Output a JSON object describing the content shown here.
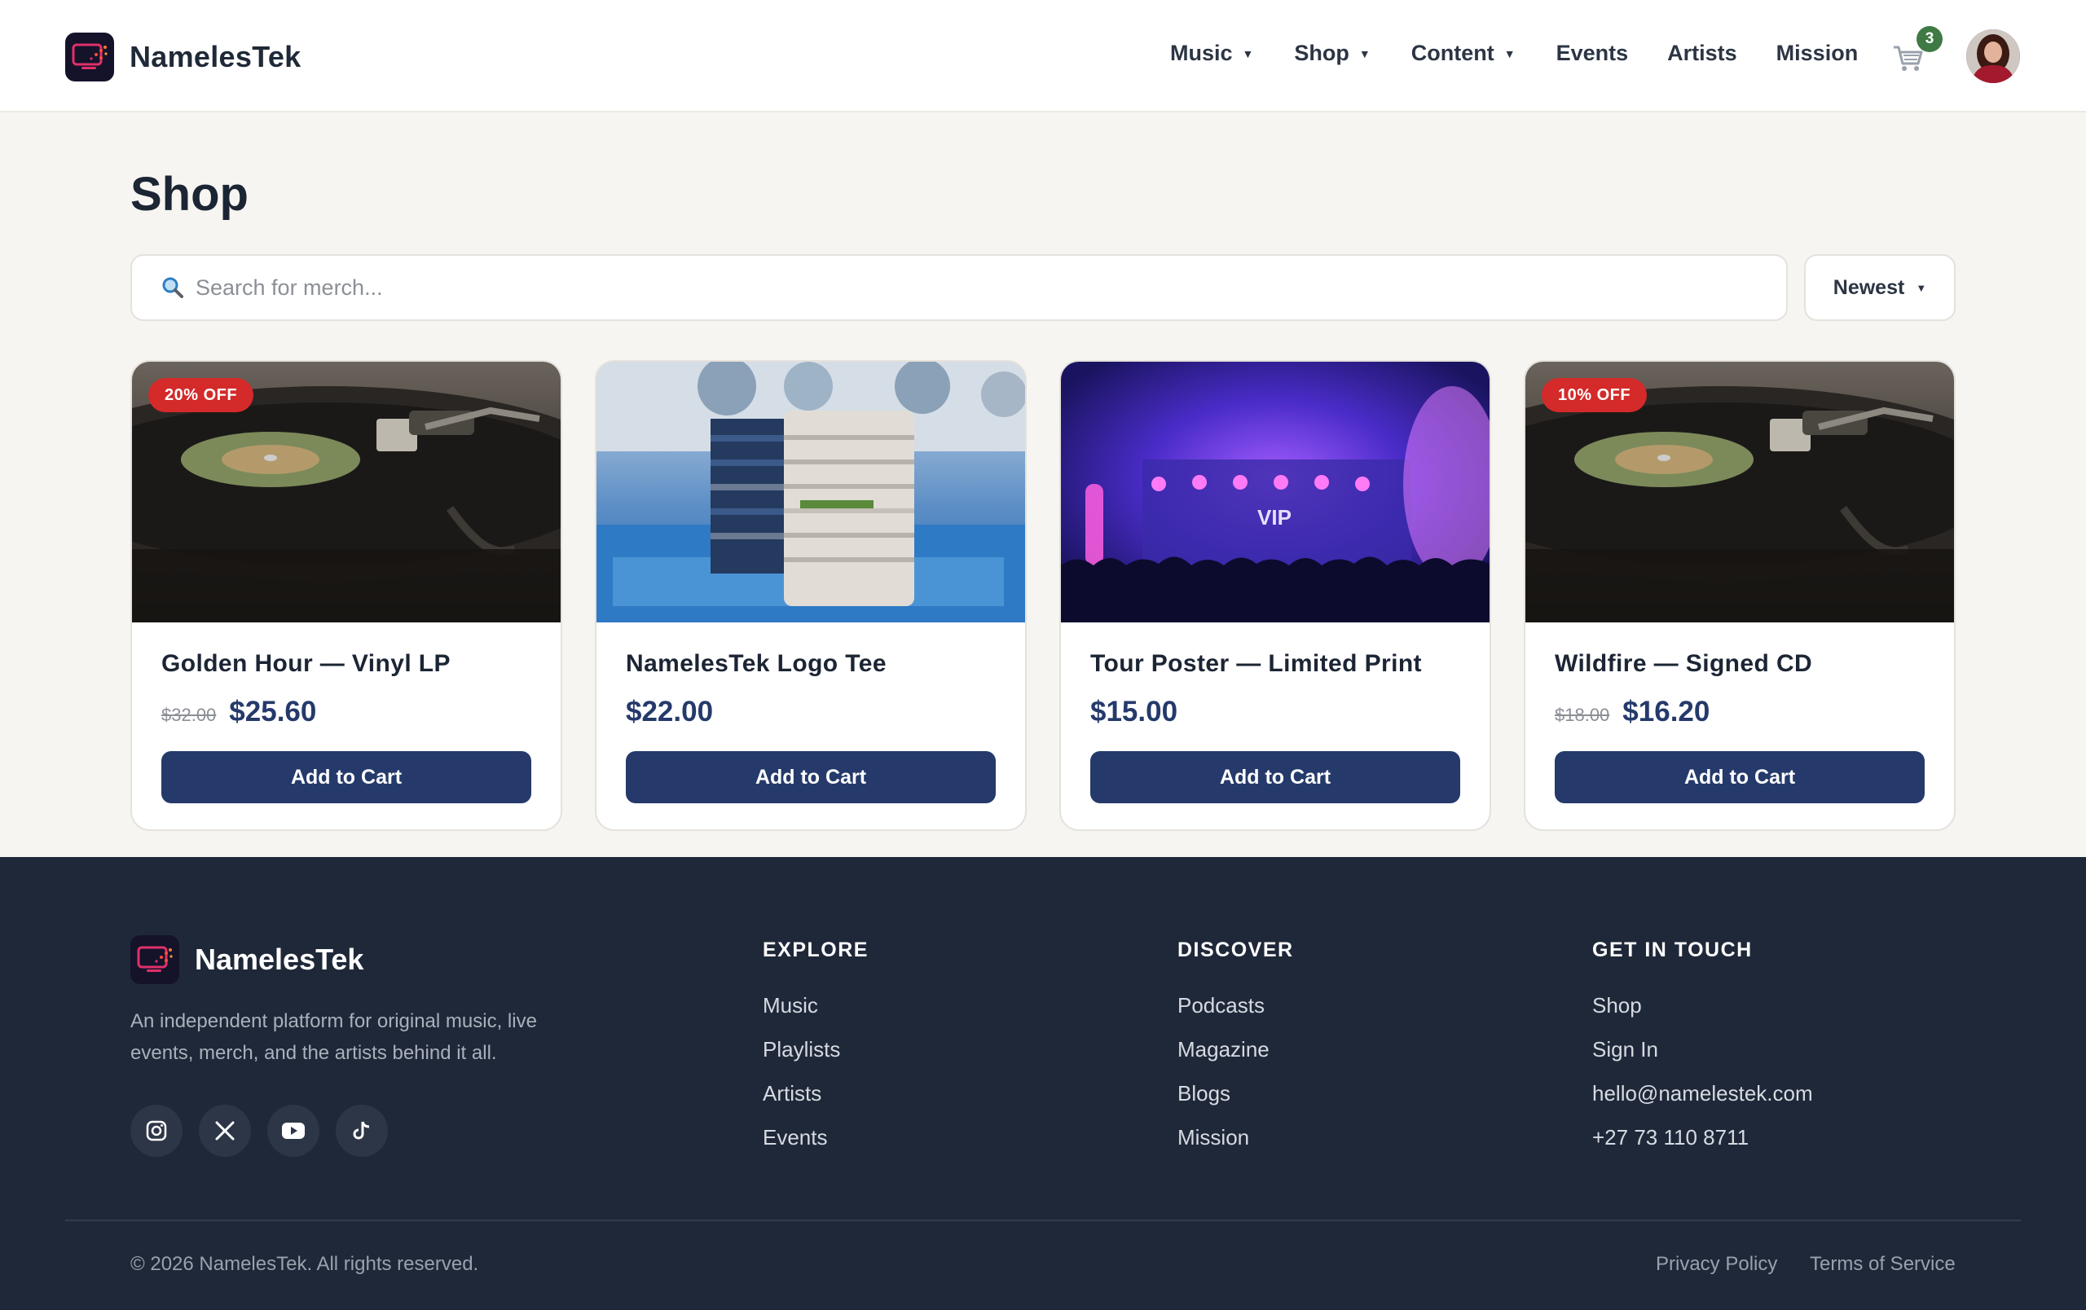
{
  "header": {
    "brand_name": "NamelesTek",
    "nav": [
      {
        "label": "Music",
        "has_dropdown": true
      },
      {
        "label": "Shop",
        "has_dropdown": true
      },
      {
        "label": "Content",
        "has_dropdown": true
      },
      {
        "label": "Events",
        "has_dropdown": false
      },
      {
        "label": "Artists",
        "has_dropdown": false
      },
      {
        "label": "Mission",
        "has_dropdown": false
      }
    ],
    "cart_icon": "cart-icon",
    "cart_count": "3",
    "avatar_icon": "user-avatar"
  },
  "main": {
    "title": "Shop",
    "search": {
      "placeholder": "Search for merch...",
      "value": "",
      "icon": "search-icon"
    },
    "sort": {
      "selected": "Newest"
    },
    "products": [
      {
        "name": "Golden Hour — Vinyl LP",
        "old_price": "$32.00",
        "price": "$25.60",
        "badge": "20% OFF",
        "image": "vinyl-turntable",
        "button": "Add to Cart"
      },
      {
        "name": "NamelesTek Logo Tee",
        "old_price": "",
        "price": "$22.00",
        "badge": "",
        "image": "folded-tshirts",
        "button": "Add to Cart"
      },
      {
        "name": "Tour Poster — Limited Print",
        "old_price": "",
        "price": "$15.00",
        "badge": "",
        "image": "concert-stage",
        "button": "Add to Cart"
      },
      {
        "name": "Wildfire — Signed CD",
        "old_price": "$18.00",
        "price": "$16.20",
        "badge": "10% OFF",
        "image": "vinyl-turntable",
        "button": "Add to Cart"
      }
    ]
  },
  "footer": {
    "brand_name": "NamelesTek",
    "description": "An independent platform for original music, live events, merch, and the artists behind it all.",
    "socials": [
      "instagram-icon",
      "x-icon",
      "youtube-icon",
      "tiktok-icon"
    ],
    "columns": [
      {
        "title": "EXPLORE",
        "links": [
          "Music",
          "Playlists",
          "Artists",
          "Events"
        ]
      },
      {
        "title": "DISCOVER",
        "links": [
          "Podcasts",
          "Magazine",
          "Blogs",
          "Mission"
        ]
      },
      {
        "title": "GET IN TOUCH",
        "links": [
          "Shop",
          "Sign In",
          "hello@namelestek.com",
          "+27 73 110 8711"
        ]
      }
    ],
    "copyright": "© 2026 NamelesTek. All rights reserved.",
    "legal": [
      "Privacy Policy",
      "Terms of Service"
    ]
  },
  "colors": {
    "primary": "#253a6b",
    "badge_red": "#d42a2a",
    "cart_badge_green": "#3f7a44",
    "footer_bg": "#1f2839",
    "page_bg": "#f6f5f1"
  }
}
